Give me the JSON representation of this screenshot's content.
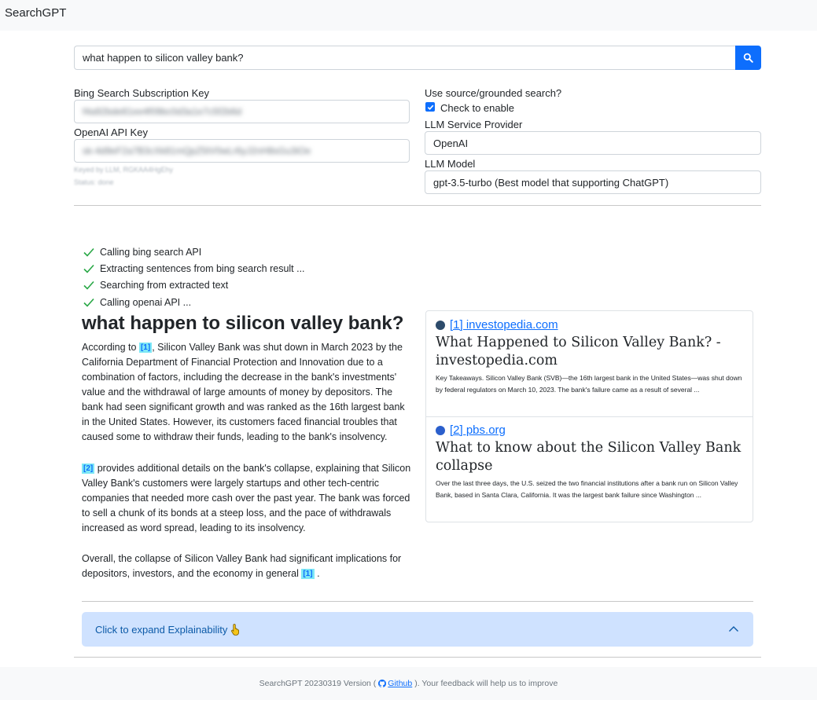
{
  "app": {
    "title": "SearchGPT"
  },
  "search": {
    "query": "what happen to silicon valley bank?"
  },
  "settings": {
    "bing_key_label": "Bing Search Subscription Key",
    "bing_key_value": "f4a92bde81ee4f09bc0d3a1e7c5f2b6d",
    "openai_key_label": "OpenAI API Key",
    "openai_key_value": "sk-4d9eF2a7B3cXk81mQpZ5tV0wLr6yJ2nH8sGu3iOe",
    "hint_line_1": "Keyed by LLM, RGKAA4HgEhy",
    "hint_line_2": "Status: done",
    "grounded_label": "Use source/grounded search?",
    "checkbox_label": "Check to enable",
    "checkbox_checked": true,
    "provider_label": "LLM Service Provider",
    "provider_value": "OpenAI",
    "model_label": "LLM Model",
    "model_value": "gpt-3.5-turbo (Best model that supporting ChatGPT)"
  },
  "progress": [
    "Calling bing search API",
    "Extracting sentences from bing search result ...",
    "Searching from extracted text",
    "Calling openai API ..."
  ],
  "answer": {
    "title": "what happen to silicon valley bank?",
    "p1_pre": "According to",
    "p1_cite": "[1]",
    "p1_text": ", Silicon Valley Bank was shut down in March 2023 by the California Department of Financial Protection and Innovation due to a combination of factors, including the decrease in the bank's investments' value and the withdrawal of large amounts of money by depositors. The bank had seen significant growth and was ranked as the 16th largest bank in the United States. However, its customers faced financial troubles that caused some to withdraw their funds, leading to the bank's insolvency.",
    "p2_cite": "[2]",
    "p2_text": "provides additional details on the bank's collapse, explaining that Silicon Valley Bank's customers were largely startups and other tech-centric companies that needed more cash over the past year. The bank was forced to sell a chunk of its bonds at a steep loss, and the pace of withdrawals increased as word spread, leading to its insolvency.",
    "p3_text": "Overall, the collapse of Silicon Valley Bank had significant implications for depositors, investors, and the economy in general",
    "p3_cite": "[1]",
    "p3_end": "."
  },
  "sources": [
    {
      "link": "[1] investopedia.com",
      "title": "What Happened to Silicon Valley Bank? - investopedia.com",
      "snippet": "Key Takeaways. Silicon Valley Bank (SVB)—the 16th largest bank in the United States—was shut down by federal regulators on March 10, 2023. The bank's failure came as a result of several ...",
      "favicon_color": "#2d4b6b"
    },
    {
      "link": "[2] pbs.org",
      "title": "What to know about the Silicon Valley Bank collapse",
      "snippet": "Over the last three days, the U.S. seized the two financial institutions after a bank run on Silicon Valley Bank, based in Santa Clara, California. It was the largest bank failure since Washington ...",
      "favicon_color": "#2b5fcc"
    }
  ],
  "explainability": {
    "label": "Click to expand Explainability"
  },
  "footer": {
    "pre": "SearchGPT 20230319 Version (",
    "link": "Github",
    "post": "). Your feedback will help us to improve"
  },
  "colors": {
    "primary": "#0d6efd",
    "accordion_bg": "#cfe2ff",
    "check_green": "#28a745",
    "cite_bg": "#7ee8f5"
  },
  "icons": [
    "search-icon",
    "check-icon",
    "pointing-hand-icon",
    "chevron-up-icon",
    "github-icon",
    "favicon-icon"
  ]
}
